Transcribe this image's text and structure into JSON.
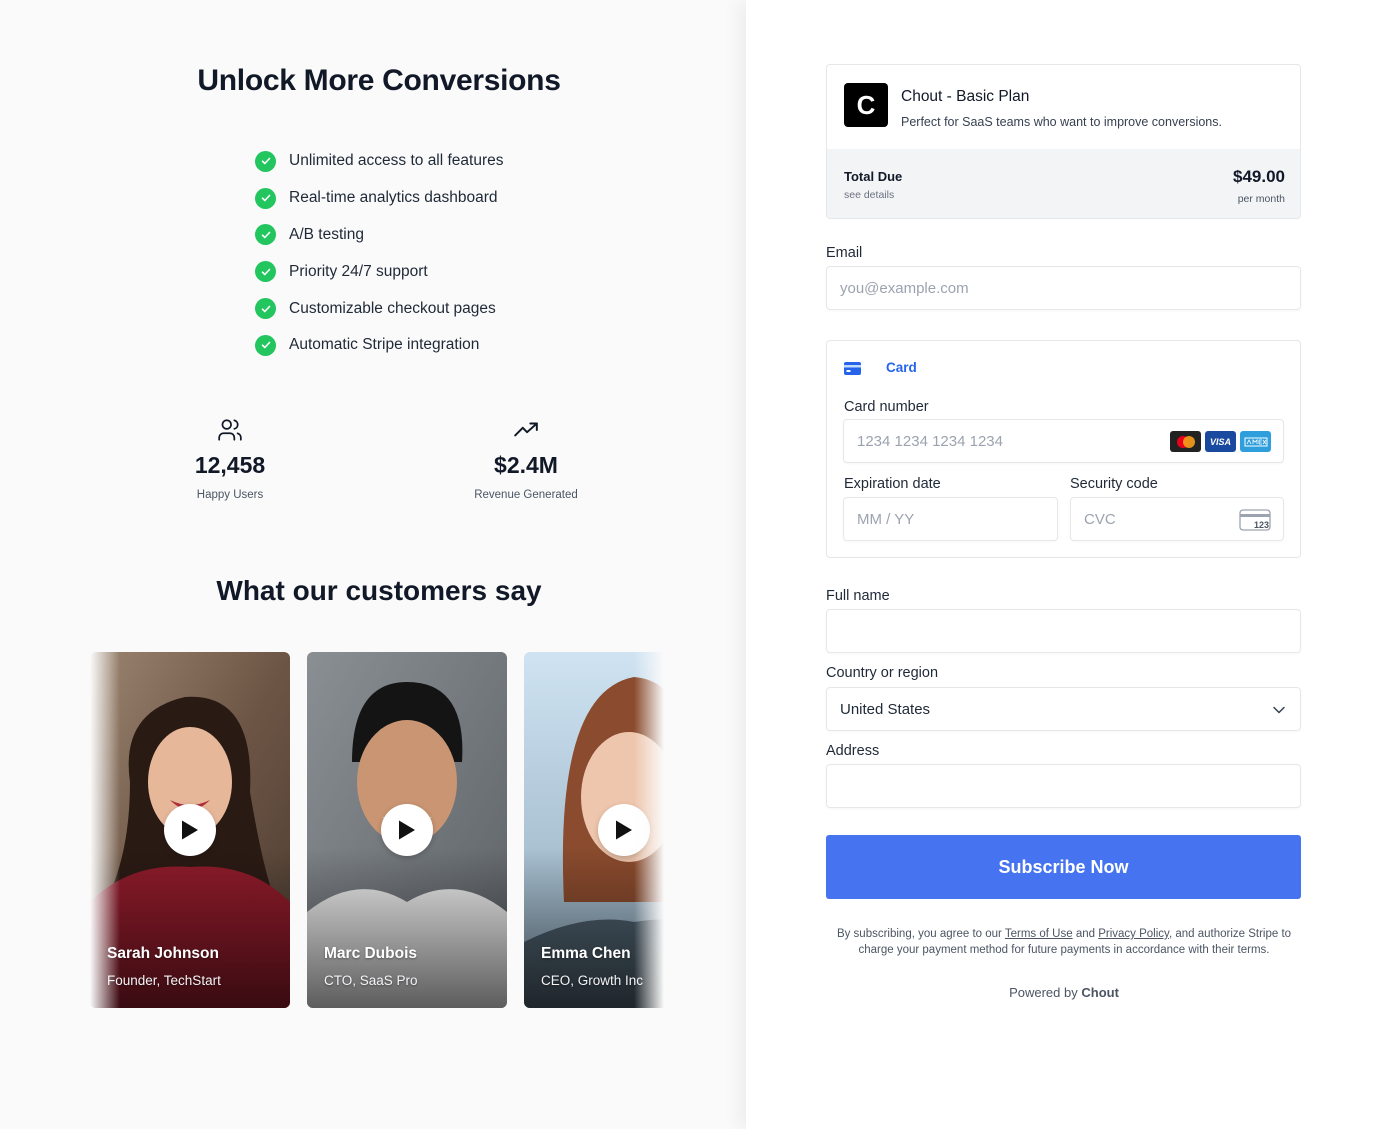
{
  "hero": {
    "title": "Unlock More Conversions",
    "features": [
      "Unlimited access to all features",
      "Real-time analytics dashboard",
      "A/B testing",
      "Priority 24/7 support",
      "Customizable checkout pages",
      "Automatic Stripe integration"
    ]
  },
  "stats": [
    {
      "icon": "users-icon",
      "value": "12,458",
      "label": "Happy Users"
    },
    {
      "icon": "trending-up-icon",
      "value": "$2.4M",
      "label": "Revenue Generated"
    }
  ],
  "testimonials": {
    "title": "What our customers say",
    "items": [
      {
        "name": "Sarah Johnson",
        "role": "Founder, TechStart"
      },
      {
        "name": "Marc Dubois",
        "role": "CTO, SaaS Pro"
      },
      {
        "name": "Emma Chen",
        "role": "CEO, Growth Inc"
      }
    ]
  },
  "plan": {
    "logo_letter": "C",
    "name": "Chout - Basic Plan",
    "description": "Perfect for SaaS teams who want to improve conversions.",
    "total_label": "Total Due",
    "total_sub": "see details",
    "amount": "$49.00",
    "period": "per month"
  },
  "form": {
    "email_label": "Email",
    "email_placeholder": "you@example.com",
    "card_tab": "Card",
    "card_number_label": "Card number",
    "card_number_placeholder": "1234 1234 1234 1234",
    "card_brands": [
      "VISA"
    ],
    "expiry_label": "Expiration date",
    "expiry_placeholder": "MM / YY",
    "cvc_label": "Security code",
    "cvc_placeholder": "CVC",
    "cvc_icon_text": "123",
    "fullname_label": "Full name",
    "country_label": "Country or region",
    "country_value": "United States",
    "address_label": "Address",
    "submit_label": "Subscribe Now"
  },
  "legal": {
    "prefix": "By subscribing, you agree to our",
    "terms": "Terms of Use",
    "and": "and",
    "privacy": "Privacy Policy",
    "suffix": ", and authorize Stripe to charge your payment method for future payments in accordance with their terms."
  },
  "footer": {
    "powered_prefix": "Powered by",
    "brand": "Chout"
  },
  "colors": {
    "accent": "#4674f0",
    "check": "#22c55e",
    "card_tab": "#2563eb"
  }
}
